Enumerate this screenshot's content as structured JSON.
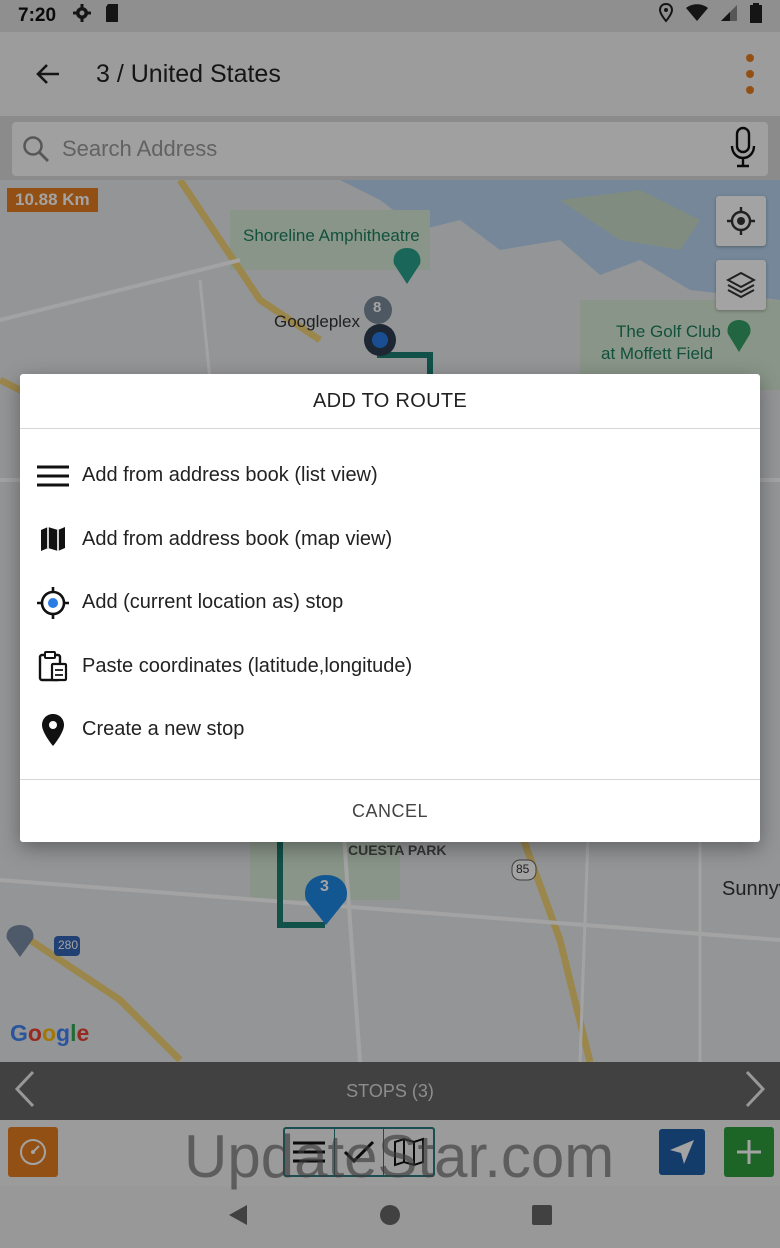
{
  "status_bar": {
    "time": "7:20"
  },
  "app_bar": {
    "title": "3 / United States"
  },
  "search": {
    "placeholder": "Search Address"
  },
  "map": {
    "distance": "10.88 Km",
    "labels": {
      "shoreline": "Shoreline Amphitheatre",
      "googleplex": "Googleplex",
      "golf_club_1": "The Golf Club",
      "golf_club_2": "at Moffett Field",
      "cuesta_park": "CUESTA PARK",
      "sunnyvale": "Sunnyv",
      "highway_85": "85",
      "highway_280": "280",
      "stop_number": "3",
      "stop_marker_top": "8"
    },
    "google_logo": "Google"
  },
  "stops_bar": {
    "label": "STOPS (3)"
  },
  "watermark": "UpdateStar.com",
  "dialog": {
    "title": "ADD TO ROUTE",
    "options": [
      {
        "label": "Add from address book (list view)",
        "icon": "list-icon"
      },
      {
        "label": "Add from address book (map view)",
        "icon": "map-icon"
      },
      {
        "label": "Add (current location as) stop",
        "icon": "current-location-icon"
      },
      {
        "label": "Paste coordinates (latitude,longitude)",
        "icon": "clipboard-icon"
      },
      {
        "label": "Create a new stop",
        "icon": "pin-icon"
      }
    ],
    "cancel": "CANCEL"
  },
  "colors": {
    "accent": "#e67e22",
    "route": "#1b7f73",
    "nav_blue": "#1f5fa8",
    "add_green": "#2e9e3e"
  }
}
